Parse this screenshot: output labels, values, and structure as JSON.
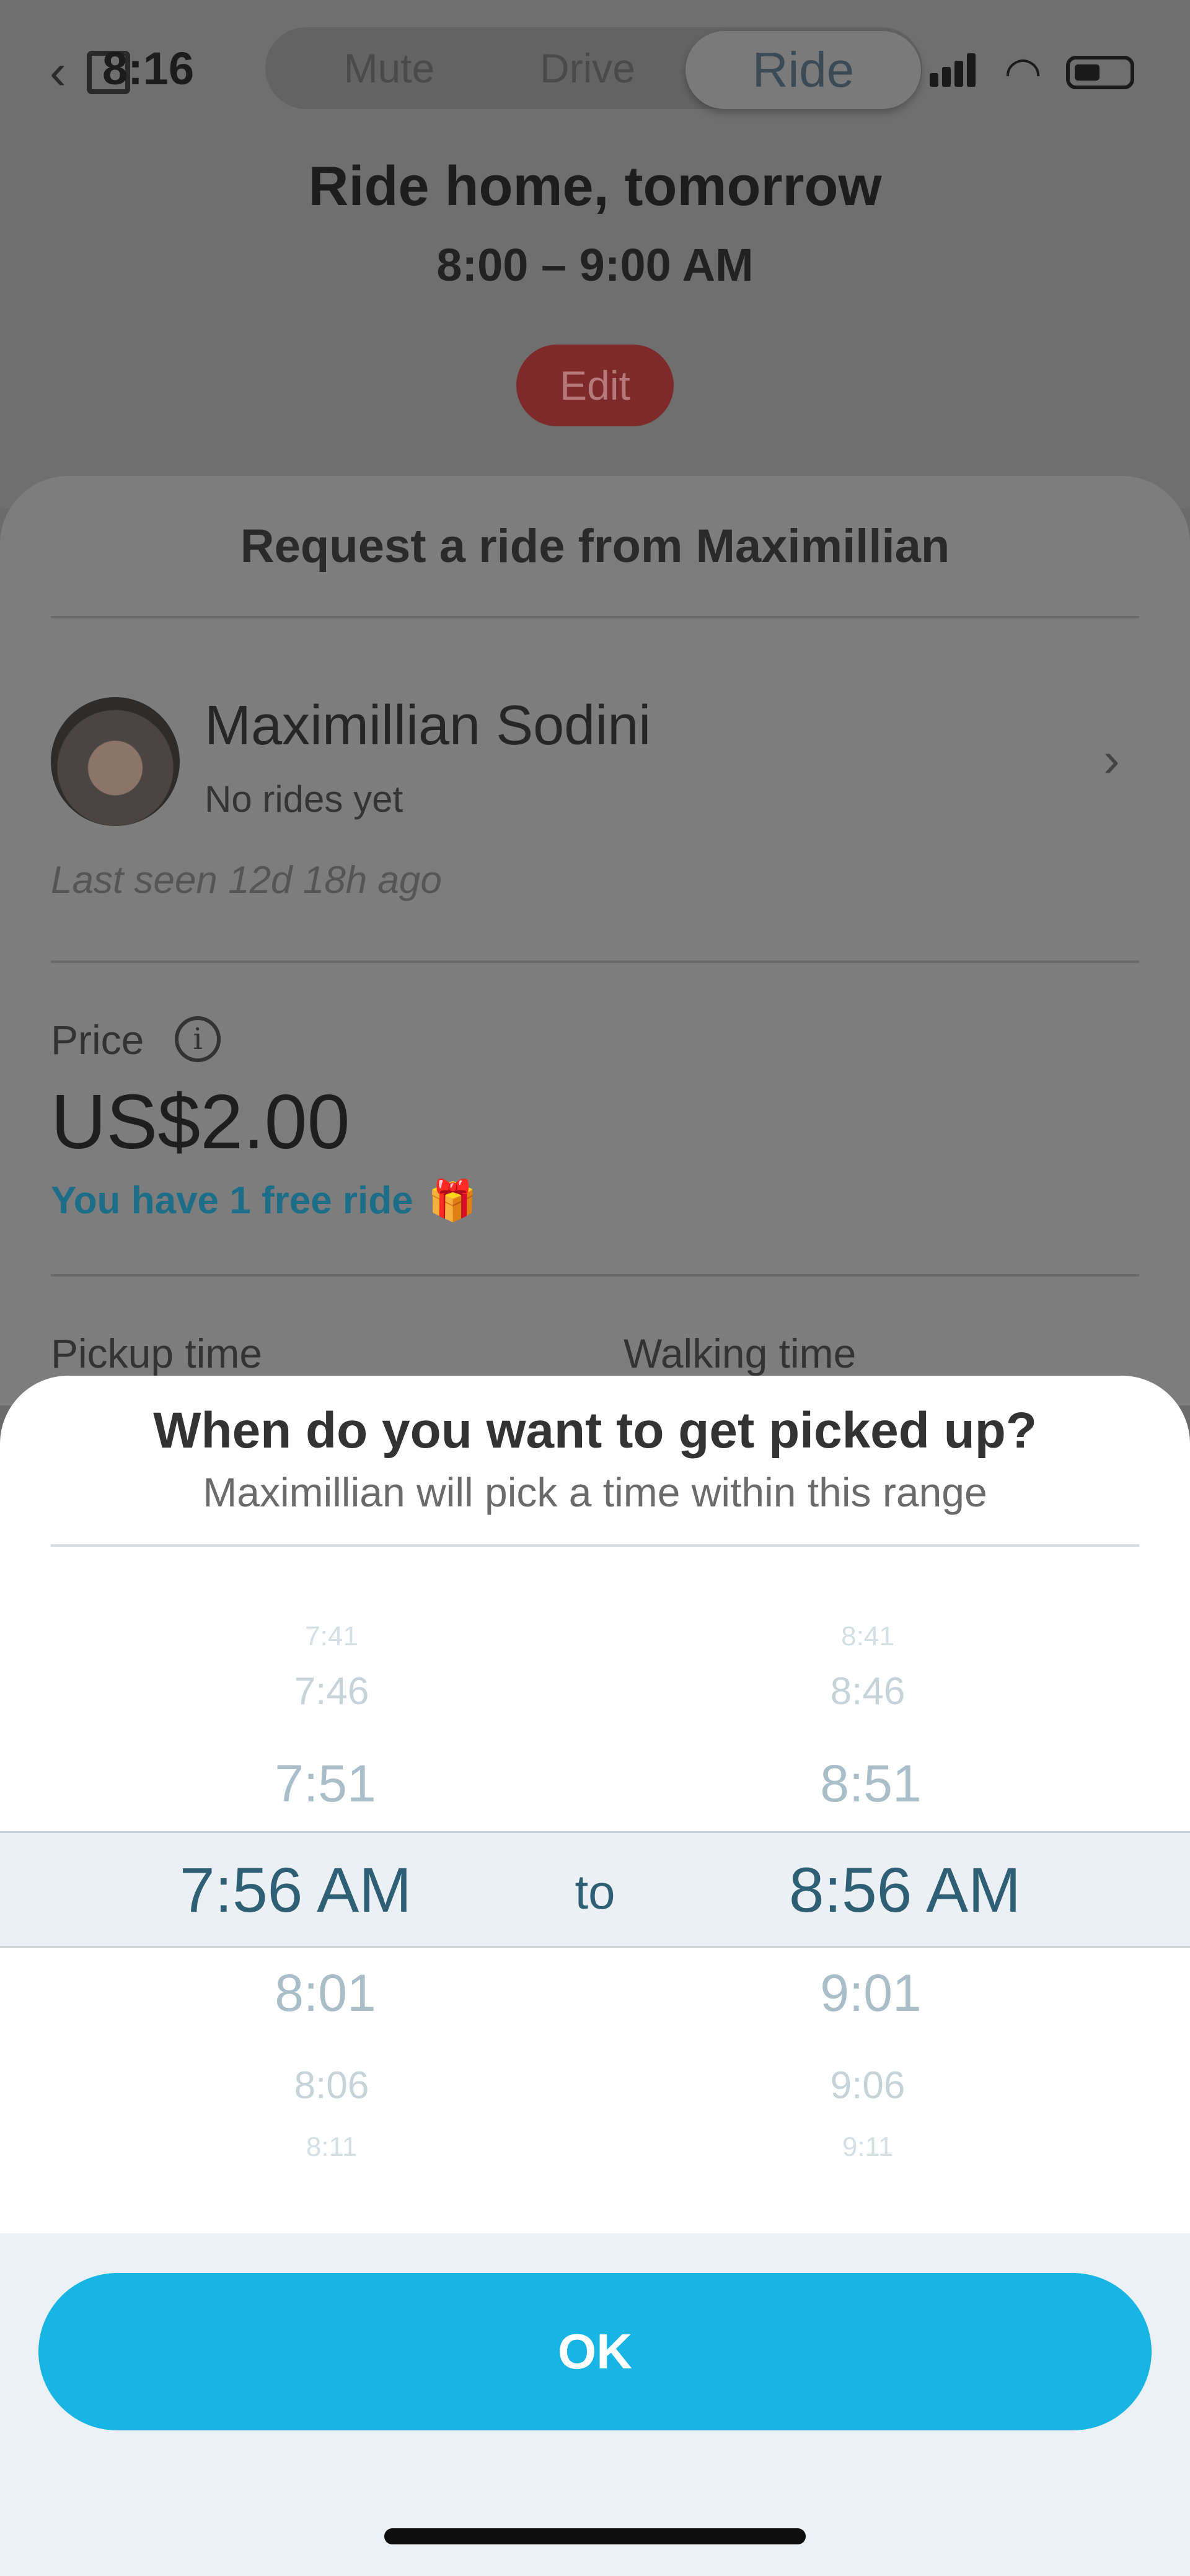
{
  "status_bar": {
    "time": "8:16"
  },
  "segmented": {
    "items": [
      "Mute",
      "Drive",
      "Ride"
    ],
    "active": "Ride"
  },
  "ride": {
    "title": "Ride home, tomorrow",
    "time_range": "8:00 – 9:00 AM",
    "edit_label": "Edit"
  },
  "request": {
    "title": "Request a ride from Maximillian",
    "driver_name": "Maximillian Sodini",
    "driver_status": "No rides yet",
    "last_seen": "Last seen 12d 18h ago",
    "price_label": "Price",
    "price_value": "US$2.00",
    "free_ride": "You have 1 free ride",
    "pickup_label": "Pickup time",
    "walking_label": "Walking time"
  },
  "picker": {
    "title": "When do you want to get picked up?",
    "subtitle": "Maximillian will pick a time within this range",
    "start": {
      "above": [
        "7:41",
        "7:46",
        "7:51"
      ],
      "selected": "7:56 AM",
      "below": [
        "8:01",
        "8:06",
        "8:11"
      ]
    },
    "end": {
      "above": [
        "8:41",
        "8:46",
        "8:51"
      ],
      "selected": "8:56 AM",
      "below": [
        "9:01",
        "9:06",
        "9:11"
      ]
    },
    "separator": "to",
    "ok_label": "OK"
  },
  "colors": {
    "accent": "#18b5e4",
    "selected_text": "#2f5f74",
    "free_ride_text": "#1b6d88"
  }
}
